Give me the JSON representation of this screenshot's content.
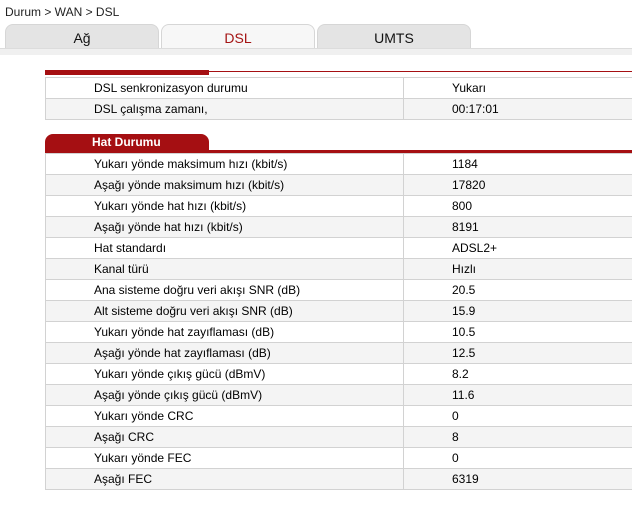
{
  "breadcrumb": "Durum > WAN > DSL",
  "tabs": [
    {
      "label": "Ağ"
    },
    {
      "label": "DSL"
    },
    {
      "label": "UMTS"
    }
  ],
  "status_rows": [
    {
      "label": "DSL senkronizasyon durumu",
      "value": "Yukarı"
    },
    {
      "label": "DSL çalışma zamanı,",
      "value": "00:17:01"
    }
  ],
  "line_section": {
    "title": "Hat Durumu",
    "rows": [
      {
        "label": "Yukarı yönde maksimum hızı (kbit/s)",
        "value": "1184"
      },
      {
        "label": "Aşağı yönde maksimum hızı (kbit/s)",
        "value": "17820"
      },
      {
        "label": "Yukarı yönde hat hızı (kbit/s)",
        "value": "800"
      },
      {
        "label": "Aşağı yönde hat hızı (kbit/s)",
        "value": "8191"
      },
      {
        "label": "Hat standardı",
        "value": "ADSL2+"
      },
      {
        "label": "Kanal türü",
        "value": "Hızlı"
      },
      {
        "label": "Ana sisteme doğru veri akışı SNR (dB)",
        "value": "20.5"
      },
      {
        "label": "Alt sisteme doğru veri akışı SNR (dB)",
        "value": "15.9"
      },
      {
        "label": "Yukarı yönde hat zayıflaması (dB)",
        "value": "10.5"
      },
      {
        "label": "Aşağı yönde hat zayıflaması (dB)",
        "value": "12.5"
      },
      {
        "label": "Yukarı yönde çıkış gücü (dBmV)",
        "value": "8.2"
      },
      {
        "label": "Aşağı yönde çıkış gücü (dBmV)",
        "value": "11.6"
      },
      {
        "label": "Yukarı yönde CRC",
        "value": "0"
      },
      {
        "label": "Aşağı CRC",
        "value": "8"
      },
      {
        "label": "Yukarı yönde FEC",
        "value": "0"
      },
      {
        "label": "Aşağı FEC",
        "value": "6319"
      }
    ]
  },
  "colors": {
    "accent": "#a50f12",
    "active_tab_text": "#a41414"
  }
}
